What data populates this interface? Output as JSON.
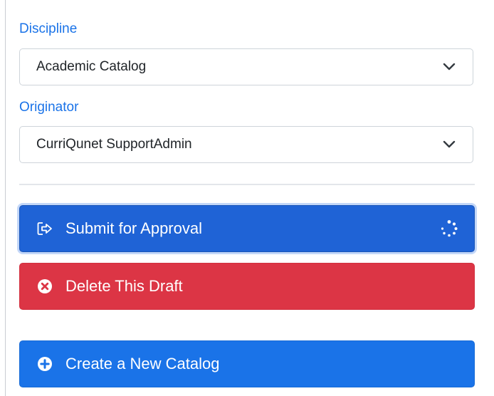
{
  "discipline": {
    "label": "Discipline",
    "value": "Academic Catalog"
  },
  "originator": {
    "label": "Originator",
    "value": "CurriQunet SupportAdmin"
  },
  "actions": {
    "submit_label": "Submit for Approval",
    "delete_label": "Delete This Draft",
    "create_label": "Create a New Catalog"
  },
  "colors": {
    "label_blue": "#1a73e8",
    "submit_blue": "#1f63d6",
    "danger_red": "#dc3545",
    "primary_blue": "#1a73e8"
  },
  "icons": {
    "submit": "sign-out-icon",
    "submit_status": "loading-spinner-icon",
    "delete": "times-circle-icon",
    "create": "plus-circle-icon",
    "select_arrow": "chevron-down-icon"
  }
}
